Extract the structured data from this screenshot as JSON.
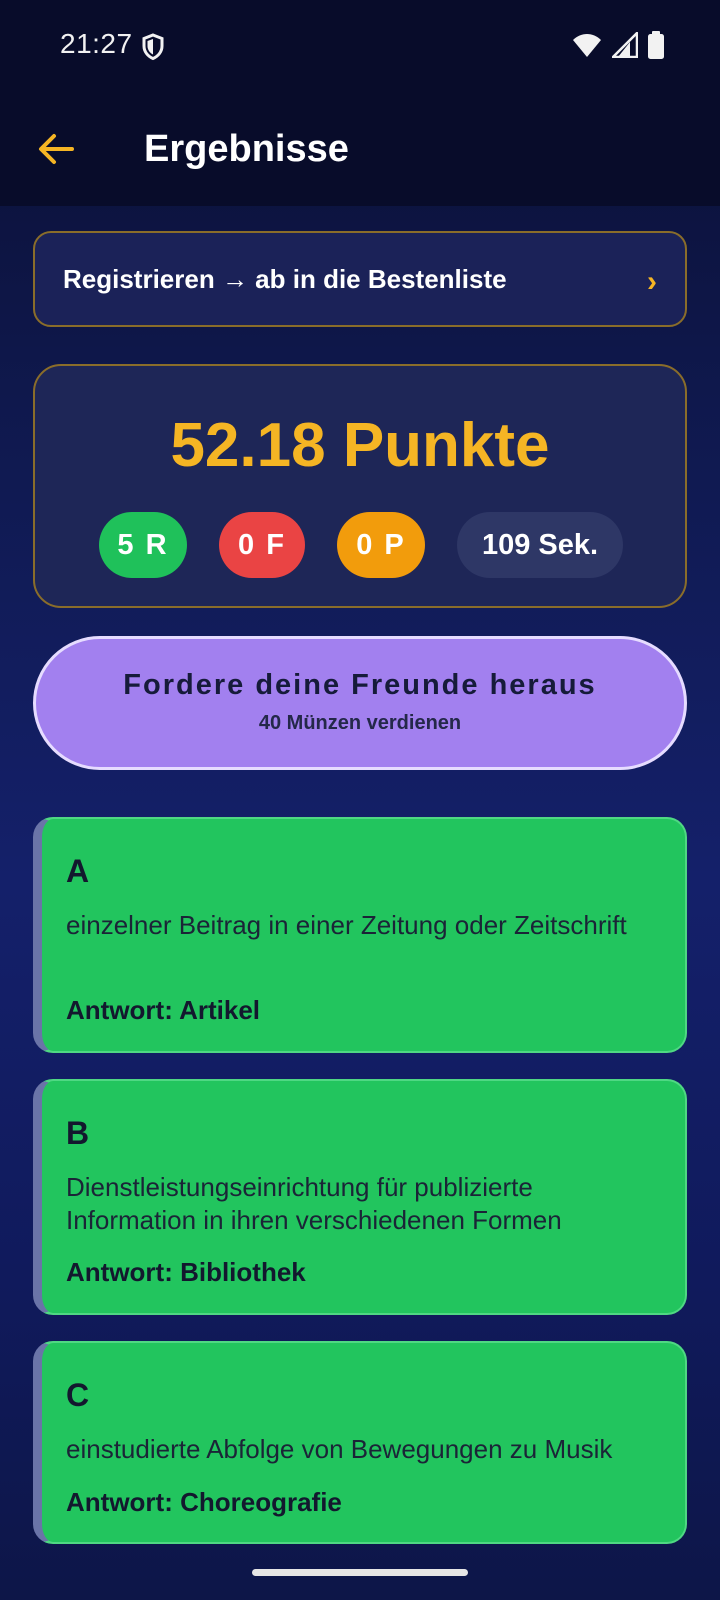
{
  "status_bar": {
    "time": "21:27"
  },
  "header": {
    "title": "Ergebnisse",
    "back_icon": "arrow-left-icon"
  },
  "register_banner": {
    "text": "Registrieren → ab in die Bestenliste",
    "chevron": "›"
  },
  "score": {
    "points_text": "52.18 Punkte",
    "right": "5 R",
    "wrong": "0 F",
    "passed": "0 P",
    "time": "109 Sek."
  },
  "challenge": {
    "title": "Fordere deine Freunde heraus",
    "subtitle": "40 Münzen verdienen"
  },
  "answers": [
    {
      "letter": "A",
      "description": "einzelner Beitrag in einer Zeitung oder Zeitschrift",
      "answer": "Antwort: Artikel"
    },
    {
      "letter": "B",
      "description": "Dienstleistungseinrichtung für publizierte Information in ihren verschiedenen Formen",
      "answer": "Antwort: Bibliothek"
    },
    {
      "letter": "C",
      "description": "einstudierte Abfolge von Bewegungen zu Musik",
      "answer": "Antwort: Choreografie"
    }
  ],
  "colors": {
    "accent": "#f5b524",
    "correct": "#22c55e",
    "wrong": "#ea4444",
    "passed": "#f29c0c",
    "challenge": "#a280ef"
  }
}
